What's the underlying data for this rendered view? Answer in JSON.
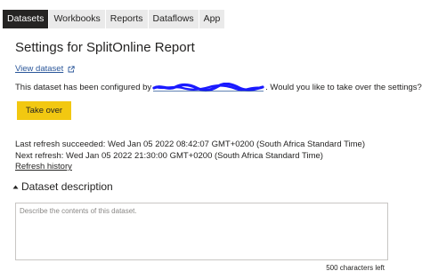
{
  "tabs": [
    {
      "label": "Datasets",
      "active": true
    },
    {
      "label": "Workbooks",
      "active": false
    },
    {
      "label": "Reports",
      "active": false
    },
    {
      "label": "Dataflows",
      "active": false
    },
    {
      "label": "App",
      "active": false
    }
  ],
  "settings": {
    "title": "Settings for SplitOnline Report",
    "view_dataset_link": "View dataset",
    "configured_prefix": "This dataset has been configured by",
    "configured_suffix": ". Would you like to take over the settings?",
    "take_over_button": "Take over"
  },
  "refresh": {
    "last_refresh": "Last refresh succeeded: Wed Jan 05 2022 08:42:07 GMT+0200 (South Africa Standard Time)",
    "next_refresh": "Next refresh: Wed Jan 05 2022 21:30:00 GMT+0200 (South Africa Standard Time)",
    "history_link": "Refresh history"
  },
  "description": {
    "section_title": "Dataset description",
    "placeholder": "Describe the contents of this dataset.",
    "value": "",
    "chars_left": "500 characters left"
  },
  "colors": {
    "accent": "#f2c811",
    "link": "#2b579a",
    "active_tab_bg": "#252423",
    "tab_bg": "#eaeaea",
    "redaction": "#1a1aff"
  }
}
